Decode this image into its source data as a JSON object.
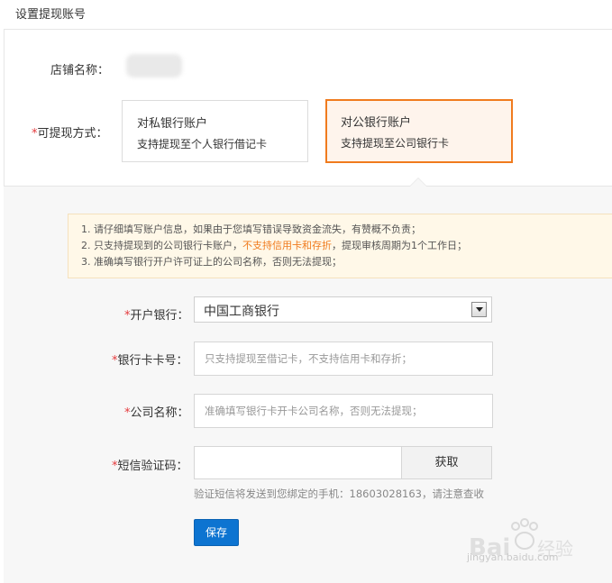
{
  "header": {
    "title": "设置提现账号"
  },
  "shop": {
    "label": "店铺名称："
  },
  "withdraw_method": {
    "required_mark": "*",
    "label": "可提现方式：",
    "options": [
      {
        "title": "对私银行账户",
        "desc": "支持提现至个人银行借记卡",
        "selected": false
      },
      {
        "title": "对公银行账户",
        "desc": "支持提现至公司银行卡",
        "selected": true
      }
    ]
  },
  "notice": {
    "line1": "1. 请仔细填写账户信息，如果由于您填写错误导致资金流失，有赞概不负责；",
    "line2_a": "2. 只支持提现到的公司银行卡账户，",
    "line2_warn": "不支持信用卡和存折",
    "line2_b": "，提现审核周期为1个工作日；",
    "line3": "3. 准确填写银行开户许可证上的公司名称，否则无法提现；"
  },
  "form": {
    "bank": {
      "required_mark": "*",
      "label": "开户银行：",
      "value": "中国工商银行"
    },
    "card_no": {
      "required_mark": "*",
      "label": "银行卡卡号：",
      "placeholder": "只支持提现至借记卡，不支持信用卡和存折；"
    },
    "company": {
      "required_mark": "*",
      "label": "公司名称：",
      "placeholder": "准确填写银行卡开卡公司名称，否则无法提现；"
    },
    "sms": {
      "required_mark": "*",
      "label": "短信验证码：",
      "button": "获取",
      "hint": "验证短信将发送到您绑定的手机：18603028163，请注意查收"
    },
    "save_label": "保存"
  },
  "watermark": {
    "text": "jingyan.baidu.com"
  },
  "colors": {
    "accent": "#f07b1e",
    "primary_button": "#0d74d1",
    "required": "#e4393c",
    "notice_bg": "#fff8e8"
  }
}
